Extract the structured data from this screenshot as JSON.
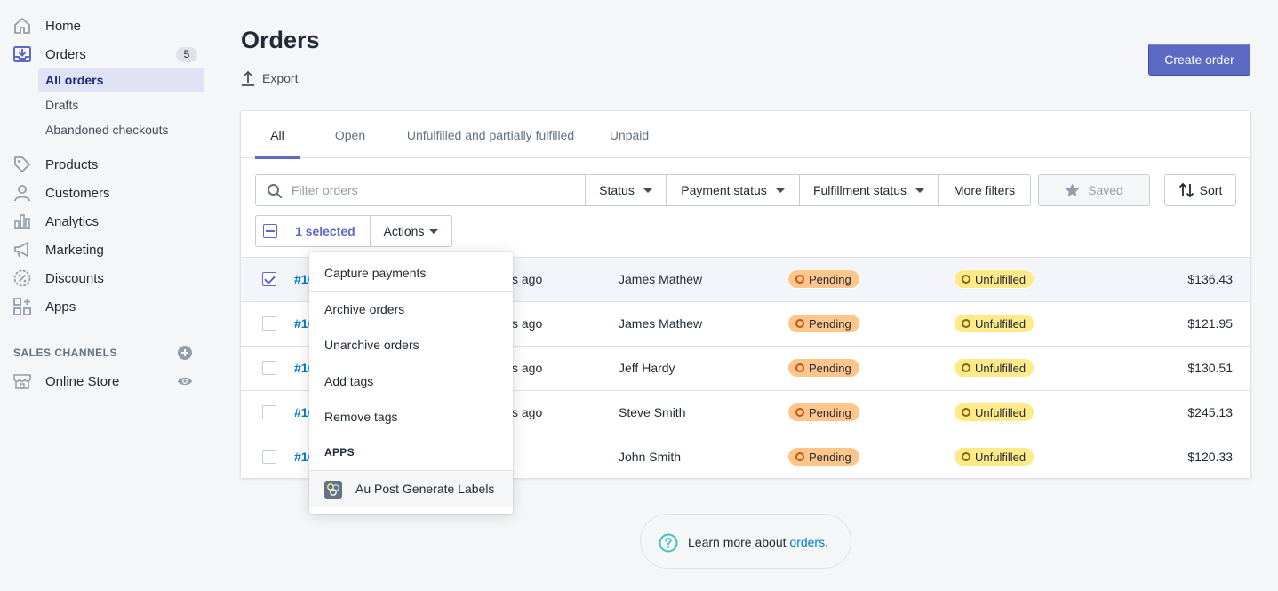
{
  "sidebar": {
    "home": "Home",
    "orders": "Orders",
    "orders_count": "5",
    "all_orders": "All orders",
    "drafts": "Drafts",
    "abandoned": "Abandoned checkouts",
    "products": "Products",
    "customers": "Customers",
    "analytics": "Analytics",
    "marketing": "Marketing",
    "discounts": "Discounts",
    "apps": "Apps",
    "sales_channels": "SALES CHANNELS",
    "online_store": "Online Store"
  },
  "header": {
    "title": "Orders",
    "export": "Export",
    "create_order": "Create order"
  },
  "tabs": [
    "All",
    "Open",
    "Unfulfilled and partially fulfilled",
    "Unpaid"
  ],
  "filters": {
    "search_placeholder": "Filter orders",
    "status": "Status",
    "payment_status": "Payment status",
    "fulfillment_status": "Fulfillment status",
    "more_filters": "More filters",
    "saved": "Saved",
    "sort": "Sort"
  },
  "bulk": {
    "selected": "1 selected",
    "actions": "Actions"
  },
  "orders": [
    {
      "number": "#10",
      "date": "s ago",
      "customer": "James Mathew",
      "payment": "Pending",
      "fulfillment": "Unfulfilled",
      "total": "$136.43",
      "checked": true
    },
    {
      "number": "#10",
      "date": "s ago",
      "customer": "James Mathew",
      "payment": "Pending",
      "fulfillment": "Unfulfilled",
      "total": "$121.95",
      "checked": false
    },
    {
      "number": "#10",
      "date": "s ago",
      "customer": "Jeff Hardy",
      "payment": "Pending",
      "fulfillment": "Unfulfilled",
      "total": "$130.51",
      "checked": false
    },
    {
      "number": "#10",
      "date": "s ago",
      "customer": "Steve Smith",
      "payment": "Pending",
      "fulfillment": "Unfulfilled",
      "total": "$245.13",
      "checked": false
    },
    {
      "number": "#10",
      "date": "",
      "customer": "John Smith",
      "payment": "Pending",
      "fulfillment": "Unfulfilled",
      "total": "$120.33",
      "checked": false
    }
  ],
  "actions_menu": {
    "capture_payments": "Capture payments",
    "archive_orders": "Archive orders",
    "unarchive_orders": "Unarchive orders",
    "add_tags": "Add tags",
    "remove_tags": "Remove tags",
    "apps_heading": "APPS",
    "au_post": "Au Post Generate Labels"
  },
  "footer": {
    "learn_prefix": "Learn more about ",
    "learn_link": "orders",
    "learn_suffix": "."
  },
  "colors": {
    "accent": "#5c6ac4",
    "link": "#007ace",
    "pending": "#ffc58b",
    "unfulfilled": "#ffea8a"
  },
  "icons": {
    "home": "home-icon",
    "orders": "orders-inbox-icon",
    "products": "tag-icon",
    "customers": "person-icon",
    "analytics": "bar-chart-icon",
    "marketing": "megaphone-icon",
    "discounts": "discount-icon",
    "apps": "apps-grid-icon",
    "online_store": "store-icon"
  }
}
